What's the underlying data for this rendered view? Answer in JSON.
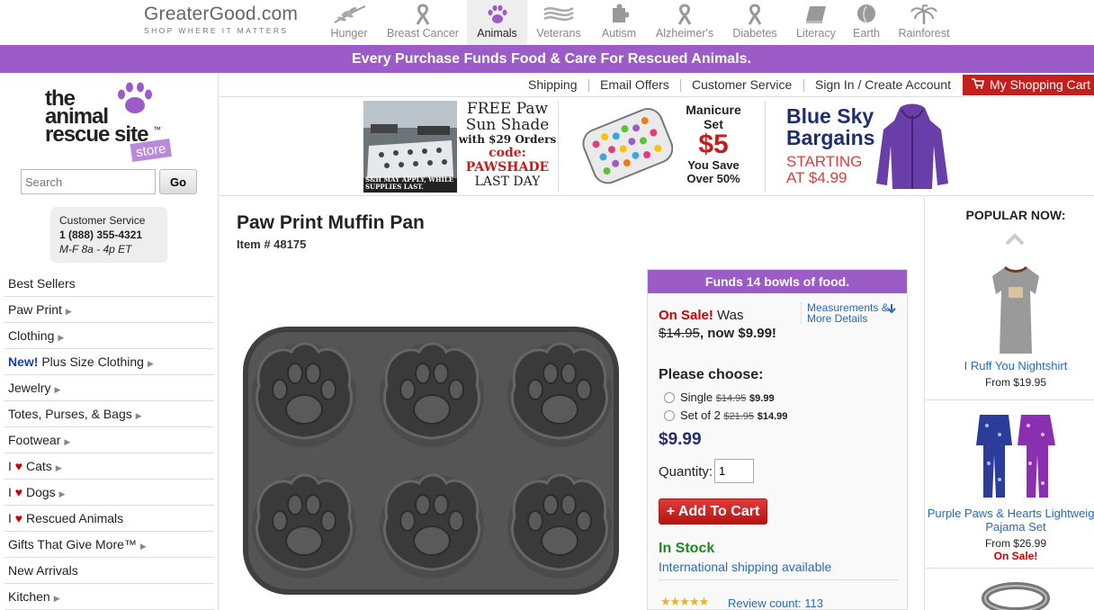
{
  "network": {
    "brand": "GreaterGood.com",
    "tagline": "SHOP WHERE IT MATTERS",
    "tabs": [
      {
        "label": "Hunger",
        "icon": "wheat-icon"
      },
      {
        "label": "Breast Cancer",
        "icon": "ribbon-icon"
      },
      {
        "label": "Animals",
        "icon": "paw-icon",
        "active": true
      },
      {
        "label": "Veterans",
        "icon": "flag-icon"
      },
      {
        "label": "Autism",
        "icon": "puzzle-icon"
      },
      {
        "label": "Alzheimer's",
        "icon": "ribbon-icon"
      },
      {
        "label": "Diabetes",
        "icon": "ribbon-icon"
      },
      {
        "label": "Literacy",
        "icon": "book-icon"
      },
      {
        "label": "Earth",
        "icon": "leaf-icon"
      },
      {
        "label": "Rainforest",
        "icon": "palm-icon"
      }
    ]
  },
  "banner": "Every Purchase Funds Food & Care For Rescued Animals.",
  "site_logo": {
    "line1": "the",
    "line2": "animal",
    "line3": "rescue site",
    "tm": "™",
    "badge": "store"
  },
  "search": {
    "placeholder": "Search",
    "button": "Go"
  },
  "customer_service": {
    "title": "Customer Service",
    "phone": "1 (888) 355-4321",
    "hours": "M-F 8a - 4p ET"
  },
  "categories": [
    {
      "label": "Best Sellers",
      "arrow": false
    },
    {
      "label": "Paw Print",
      "arrow": true
    },
    {
      "label": "Clothing",
      "arrow": true
    },
    {
      "prefix": "New!",
      "label": " Plus Size Clothing",
      "arrow": true
    },
    {
      "label": "Jewelry",
      "arrow": true
    },
    {
      "label": "Totes, Purses, & Bags",
      "arrow": true
    },
    {
      "label": "Footwear",
      "arrow": true
    },
    {
      "pre": "I ",
      "heart": "♥",
      "label": " Cats",
      "arrow": true
    },
    {
      "pre": "I ",
      "heart": "♥",
      "label": " Dogs",
      "arrow": true
    },
    {
      "pre": "I ",
      "heart": "♥",
      "label": " Rescued Animals",
      "arrow": false
    },
    {
      "label": "Gifts That Give More™",
      "arrow": true
    },
    {
      "label": "New Arrivals",
      "arrow": false
    },
    {
      "label": "Kitchen",
      "arrow": true
    }
  ],
  "util_nav": {
    "links": [
      "Shipping",
      "Email Offers",
      "Customer Service",
      "Sign In / Create Account"
    ],
    "cart": "My Shopping Cart"
  },
  "promos": {
    "sunshade": {
      "l1": "FREE Paw",
      "l2": "Sun Shade",
      "l3": "with $29 Orders",
      "l4": "code:",
      "l5": "PAWSHADE",
      "l6": "LAST DAY",
      "fine": "S&H MAY APPLY, WHILE SUPPLIES LAST."
    },
    "manicure": {
      "l1": "Manicure",
      "l2": "Set",
      "l3": "$5",
      "l4": "You Save",
      "l5": "Over 50%"
    },
    "bluesky": {
      "l1": "Blue Sky",
      "l2": "Bargains",
      "l3": "STARTING",
      "l4": "AT $4.99"
    }
  },
  "product": {
    "title": "Paw Print Muffin Pan",
    "item": "Item # 48175",
    "funds": "Funds 14 bowls of food.",
    "on_sale": "On Sale!",
    "was": " Was",
    "old_price": "$14.95",
    "now": ", now $9.99!",
    "measurements": "Measurements & More Details",
    "choose": "Please choose:",
    "options": [
      {
        "label": "Single",
        "old": "$14.95",
        "price": "$9.99"
      },
      {
        "label": "Set of 2",
        "old": "$21.95",
        "price": "$14.99"
      }
    ],
    "price": "$9.99",
    "qty_label": "Quantity:",
    "qty_value": "1",
    "add_to_cart": "+ Add To Cart",
    "in_stock": "In Stock",
    "intl": "International shipping available",
    "stars": "★★★★★",
    "review_label": "Review count:",
    "review_count": "113"
  },
  "popular": {
    "title": "POPULAR NOW:",
    "items": [
      {
        "name": "I Ruff You Nightshirt",
        "from": "From $19.95"
      },
      {
        "name": "Purple Paws & Hearts Lightweight Pajama Set",
        "from": "From $26.99",
        "sale": "On Sale!"
      }
    ]
  },
  "colors": {
    "purple": "#9b5cc7",
    "red": "#c41e1e",
    "link": "#2a6ab0",
    "price_navy": "#232e70",
    "stock_green": "#1e8a1e"
  }
}
